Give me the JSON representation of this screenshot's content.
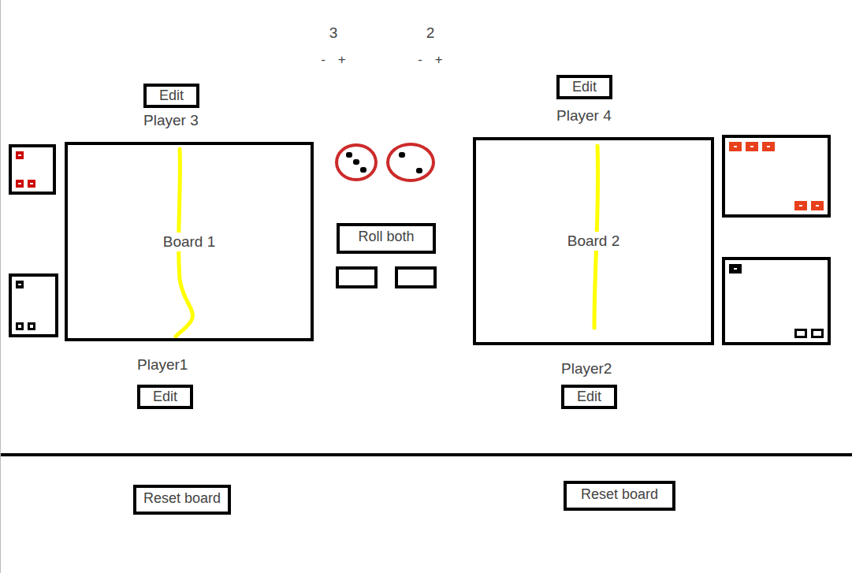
{
  "counters": [
    {
      "value": "3",
      "minus": "-",
      "plus": "+"
    },
    {
      "value": "2",
      "minus": "-",
      "plus": "+"
    }
  ],
  "dice": [
    {
      "pips": 3
    },
    {
      "pips": 2
    }
  ],
  "roll_button": "Roll both",
  "boards": [
    {
      "title": "Board 1",
      "top_player": "Player 3",
      "bottom_player": "Player1",
      "edit_top": "Edit",
      "edit_bottom": "Edit",
      "reset": "Reset board",
      "trays": [
        {
          "color": "#cc0000",
          "groups": [
            {
              "count": 1,
              "hollow": false
            },
            {
              "count": 2,
              "hollow": false
            }
          ]
        },
        {
          "color": "#000000",
          "groups": [
            {
              "count": 1,
              "hollow": false
            },
            {
              "count": 2,
              "hollow": true
            }
          ]
        }
      ]
    },
    {
      "title": "Board 2",
      "top_player": "Player 4",
      "bottom_player": "Player2",
      "edit_top": "Edit",
      "edit_bottom": "Edit",
      "reset": "Reset board",
      "trays": [
        {
          "color": "#e8401c",
          "groups": [
            {
              "count": 3,
              "hollow": false
            },
            {
              "count": 2,
              "hollow": false
            }
          ]
        },
        {
          "color": "#000000",
          "groups": [
            {
              "count": 1,
              "hollow": false
            },
            {
              "count": 2,
              "hollow": true
            }
          ]
        }
      ]
    }
  ]
}
